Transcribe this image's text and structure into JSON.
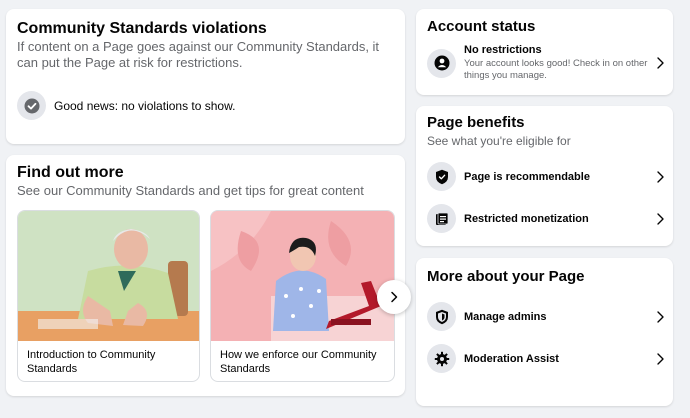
{
  "violations": {
    "title": "Community Standards violations",
    "description": "If content on a Page goes against our Community Standards, it can put the Page at risk for restrictions.",
    "status_text": "Good news: no violations to show.",
    "status_icon": "check-circle-icon"
  },
  "find_out_more": {
    "title": "Find out more",
    "subtitle": "See our Community Standards and get tips for great content",
    "articles": [
      {
        "label": "Introduction to Community Standards"
      },
      {
        "label": "How we enforce our Community Standards"
      }
    ],
    "next_icon": "chevron-right-icon"
  },
  "account_status": {
    "title": "Account status",
    "item": {
      "label": "No restrictions",
      "description": "Your account looks good! Check in on other things you manage.",
      "icon": "person-icon"
    }
  },
  "page_benefits": {
    "title": "Page benefits",
    "subtitle": "See what you're eligible for",
    "items": [
      {
        "label": "Page is recommendable",
        "icon": "shield-icon"
      },
      {
        "label": "Restricted monetization",
        "icon": "money-icon"
      }
    ]
  },
  "more_about": {
    "title": "More about your Page",
    "items": [
      {
        "label": "Manage admins",
        "icon": "admin-shield-icon"
      },
      {
        "label": "Moderation Assist",
        "icon": "gear-icon"
      }
    ]
  }
}
